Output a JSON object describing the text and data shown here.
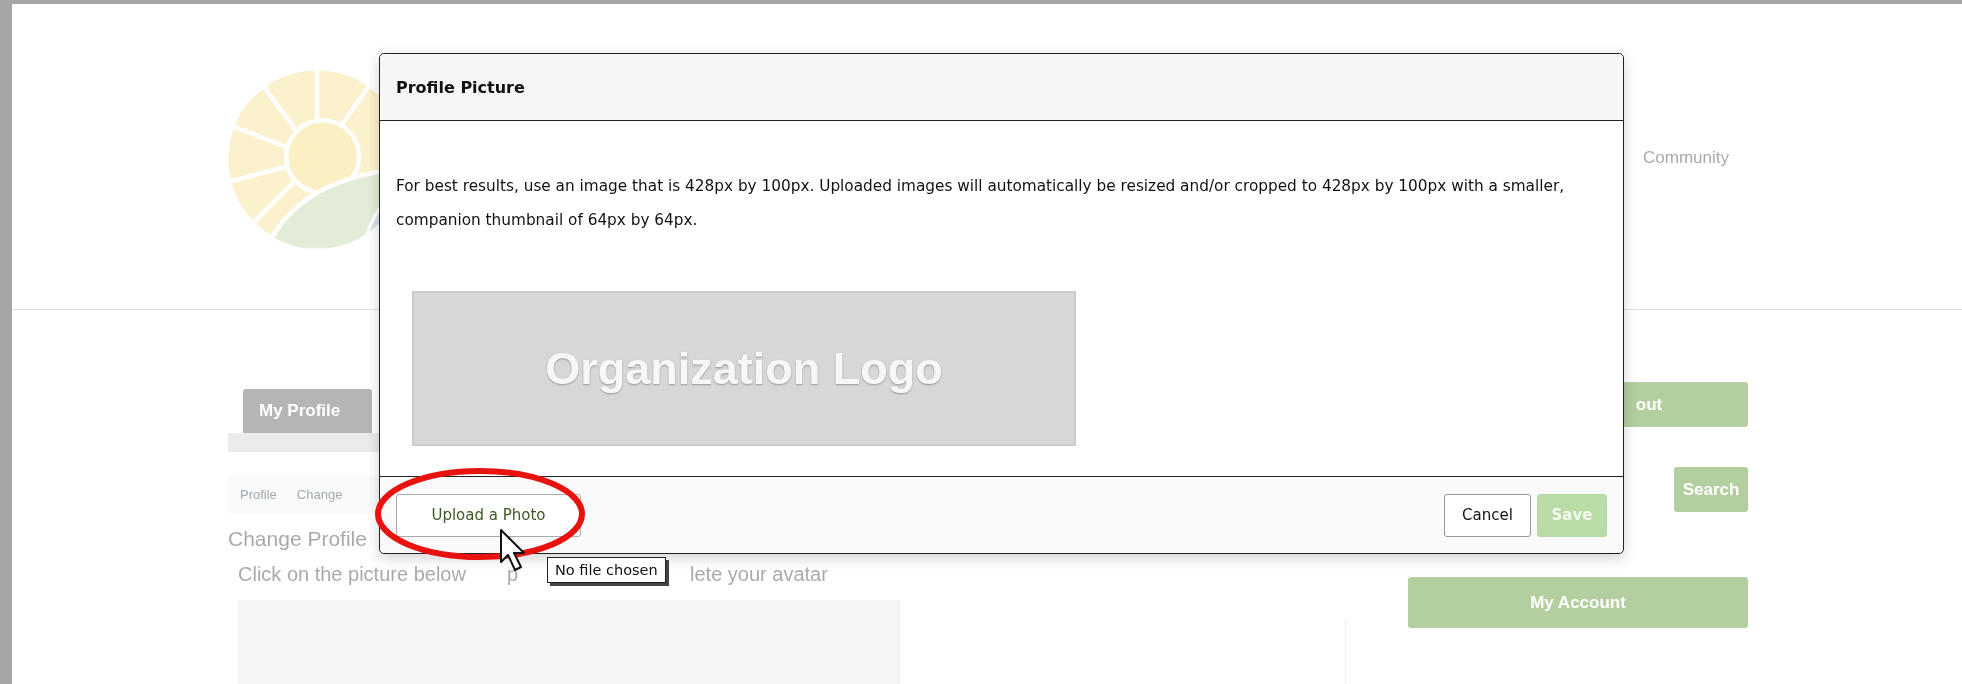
{
  "site": {
    "nav_link": "Community"
  },
  "profile_tabs": [
    {
      "label": "My Profile",
      "selected": true
    }
  ],
  "breadcrumb": [
    "Profile",
    "Change"
  ],
  "section_title": "Change Profile",
  "instruction_fragments": [
    "Click on the picture below",
    "p",
    "lete your avatar"
  ],
  "sidebar": {
    "buttons": [
      {
        "label": "out",
        "kind": "logout"
      },
      {
        "label": "Search",
        "kind": "search"
      },
      {
        "label": "My Account",
        "kind": "account"
      }
    ]
  },
  "dialog": {
    "title": "Profile Picture",
    "description": "For best results, use an image that is 428px by 100px. Uploaded images will automatically be resized and/or cropped to 428px by 100px with a smaller, companion thumbnail of 64px by 64px.",
    "logo_placeholder": "Organization Logo",
    "buttons": [
      {
        "label": "Upload a Photo",
        "kind": "upload",
        "disabled": false
      },
      {
        "label": "Cancel",
        "kind": "cancel",
        "disabled": false
      },
      {
        "label": "Save",
        "kind": "save",
        "disabled": true
      }
    ]
  },
  "tooltip": "No file chosen"
}
